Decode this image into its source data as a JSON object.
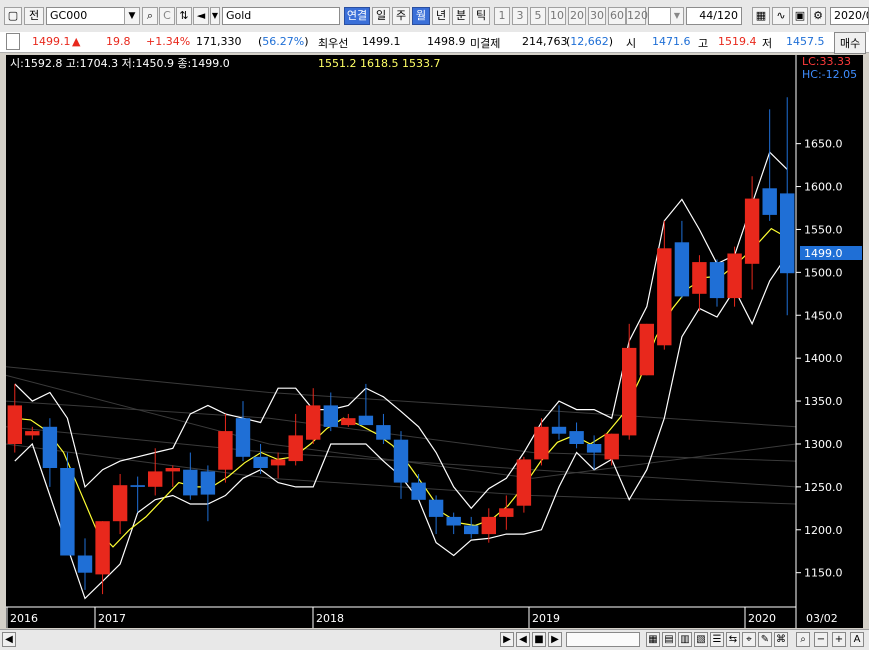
{
  "toolbar": {
    "mode_label": "전",
    "code_value": "GC000",
    "name_value": "Gold",
    "tab_link": "연결",
    "tab_day": "일",
    "tab_week": "주",
    "tab_month": "월",
    "tab_year": "년",
    "tab_minute": "분",
    "tab_tick": "틱",
    "intervals": [
      "1",
      "3",
      "5",
      "10",
      "20",
      "30",
      "60",
      "120"
    ],
    "count_value": "44",
    "count_total": "/120",
    "date_value": "2020/0"
  },
  "quote": {
    "price": "1499.1",
    "change": "19.8",
    "change_pct": "+1.34%",
    "volume": "171,330",
    "volume_ratio": "56.27%",
    "best_label": "최우선",
    "best_ask": "1499.1",
    "best_bid": "1498.9",
    "open_interest_label": "미결제",
    "open_interest": "214,763",
    "oi_change": "12,662",
    "open_label": "시",
    "open": "1471.6",
    "high_label": "고",
    "high": "1519.4",
    "low_label": "저",
    "low": "1457.5",
    "buy_label": "매수",
    "up_color": "#e8281c",
    "down_color": "#1f6fd6"
  },
  "chart_header": {
    "ohlc_text": "시:1592.8 고:1704.3 저:1450.9 종:1499.0",
    "ma_text": "1551.2 1618.5 1533.7",
    "lc_text": "LC:33.33",
    "hc_text": "HC:-12.05",
    "current_price_tag": "1499.0",
    "date_corner": "03/02"
  },
  "chart_data": {
    "type": "candlestick",
    "ylim": [
      1110,
      1730
    ],
    "yticks": [
      "1650.0",
      "1600.0",
      "1550.0",
      "1500.0",
      "1450.0",
      "1400.0",
      "1350.0",
      "1300.0",
      "1250.0",
      "1200.0",
      "1150.0"
    ],
    "x_labels": [
      "2016",
      "2017",
      "2018",
      "2019",
      "2020"
    ],
    "candles": [
      [
        1300,
        1370,
        1290,
        1345
      ],
      [
        1310,
        1320,
        1305,
        1315
      ],
      [
        1320,
        1330,
        1250,
        1272
      ],
      [
        1272,
        1290,
        1170,
        1170
      ],
      [
        1170,
        1190,
        1130,
        1150
      ],
      [
        1148,
        1210,
        1125,
        1210
      ],
      [
        1210,
        1265,
        1195,
        1252
      ],
      [
        1252,
        1262,
        1220,
        1250
      ],
      [
        1250,
        1295,
        1240,
        1268
      ],
      [
        1268,
        1275,
        1250,
        1272
      ],
      [
        1270,
        1290,
        1235,
        1240
      ],
      [
        1268,
        1275,
        1210,
        1241
      ],
      [
        1270,
        1335,
        1255,
        1315
      ],
      [
        1330,
        1350,
        1280,
        1285
      ],
      [
        1285,
        1300,
        1265,
        1272
      ],
      [
        1275,
        1290,
        1260,
        1282
      ],
      [
        1280,
        1335,
        1275,
        1310
      ],
      [
        1305,
        1365,
        1300,
        1345
      ],
      [
        1345,
        1360,
        1315,
        1320
      ],
      [
        1322,
        1335,
        1320,
        1330
      ],
      [
        1333,
        1370,
        1325,
        1322
      ],
      [
        1322,
        1335,
        1300,
        1305
      ],
      [
        1305,
        1315,
        1236,
        1255
      ],
      [
        1255,
        1265,
        1235,
        1235
      ],
      [
        1235,
        1240,
        1195,
        1215
      ],
      [
        1215,
        1220,
        1195,
        1205
      ],
      [
        1205,
        1215,
        1190,
        1195
      ],
      [
        1195,
        1225,
        1185,
        1215
      ],
      [
        1215,
        1240,
        1200,
        1225
      ],
      [
        1228,
        1285,
        1220,
        1282
      ],
      [
        1282,
        1330,
        1275,
        1320
      ],
      [
        1320,
        1345,
        1305,
        1312
      ],
      [
        1315,
        1325,
        1295,
        1300
      ],
      [
        1300,
        1310,
        1270,
        1290
      ],
      [
        1282,
        1312,
        1275,
        1312
      ],
      [
        1310,
        1440,
        1305,
        1412
      ],
      [
        1380,
        1440,
        1380,
        1440
      ],
      [
        1415,
        1560,
        1410,
        1528
      ],
      [
        1535,
        1560,
        1470,
        1472
      ],
      [
        1475,
        1520,
        1455,
        1512
      ],
      [
        1512,
        1515,
        1460,
        1470
      ],
      [
        1470,
        1530,
        1460,
        1522
      ],
      [
        1510,
        1612,
        1480,
        1586
      ],
      [
        1598,
        1690,
        1560,
        1567
      ],
      [
        1592,
        1704,
        1450,
        1499
      ]
    ],
    "ma_series": [
      1330,
      1328,
      1315,
      1290,
      1245,
      1200,
      1180,
      1200,
      1215,
      1235,
      1255,
      1250,
      1250,
      1262,
      1278,
      1290,
      1282,
      1285,
      1300,
      1318,
      1330,
      1322,
      1312,
      1298,
      1275,
      1248,
      1220,
      1208,
      1205,
      1212,
      1228,
      1252,
      1280,
      1302,
      1310,
      1300,
      1312,
      1335,
      1375,
      1425,
      1458,
      1482,
      1494,
      1496,
      1512,
      1530,
      1551,
      1540
    ],
    "bollinger_upper": [
      1370,
      1350,
      1360,
      1330,
      1250,
      1270,
      1280,
      1285,
      1290,
      1295,
      1335,
      1345,
      1335,
      1330,
      1325,
      1365,
      1365,
      1340,
      1340,
      1345,
      1365,
      1355,
      1338,
      1320,
      1290,
      1250,
      1225,
      1248,
      1260,
      1290,
      1325,
      1350,
      1340,
      1340,
      1330,
      1420,
      1460,
      1560,
      1585,
      1550,
      1510,
      1520,
      1580,
      1640,
      1620
    ],
    "bollinger_lower": [
      1280,
      1300,
      1240,
      1180,
      1120,
      1140,
      1160,
      1220,
      1235,
      1240,
      1230,
      1230,
      1240,
      1260,
      1270,
      1255,
      1250,
      1250,
      1300,
      1300,
      1300,
      1280,
      1262,
      1235,
      1185,
      1170,
      1188,
      1190,
      1195,
      1195,
      1200,
      1250,
      1290,
      1270,
      1282,
      1235,
      1270,
      1330,
      1425,
      1458,
      1448,
      1480,
      1440,
      1490,
      1520
    ]
  },
  "scrollbar": {
    "play_back": "◀",
    "play_fwd": "▶",
    "stop": "■",
    "zoom_out": "−",
    "zoom_in": "+",
    "text_tool": "A"
  }
}
